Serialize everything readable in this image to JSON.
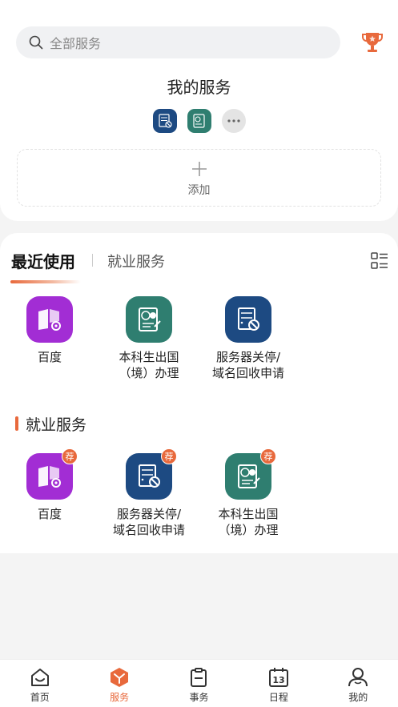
{
  "search": {
    "placeholder": "全部服务"
  },
  "my_services": {
    "title": "我的服务",
    "add_label": "添加"
  },
  "tabs": {
    "active": "最近使用",
    "other": "就业服务"
  },
  "recent": [
    {
      "label": "百度",
      "icon": "book-gear-icon",
      "color": "#a22dd4"
    },
    {
      "label": "本科生出国\n（境）办理",
      "icon": "passport-icon",
      "color": "#2f7e70"
    },
    {
      "label": "服务器关停/\n域名回收申请",
      "icon": "server-stop-icon",
      "color": "#1d4a82"
    }
  ],
  "employment": {
    "title": "就业服务",
    "badge": "荐",
    "items": [
      {
        "label": "百度",
        "icon": "book-gear-icon",
        "color": "#a22dd4"
      },
      {
        "label": "服务器关停/\n域名回收申请",
        "icon": "server-stop-icon",
        "color": "#1d4a82"
      },
      {
        "label": "本科生出国\n（境）办理",
        "icon": "passport-icon",
        "color": "#2f7e70"
      }
    ]
  },
  "nav": [
    {
      "label": "首页",
      "icon": "home-icon"
    },
    {
      "label": "服务",
      "icon": "cube-icon",
      "active": true
    },
    {
      "label": "事务",
      "icon": "clipboard-icon"
    },
    {
      "label": "日程",
      "icon": "calendar-icon",
      "day": "13"
    },
    {
      "label": "我的",
      "icon": "person-icon"
    }
  ],
  "accent_color": "#e8693c"
}
